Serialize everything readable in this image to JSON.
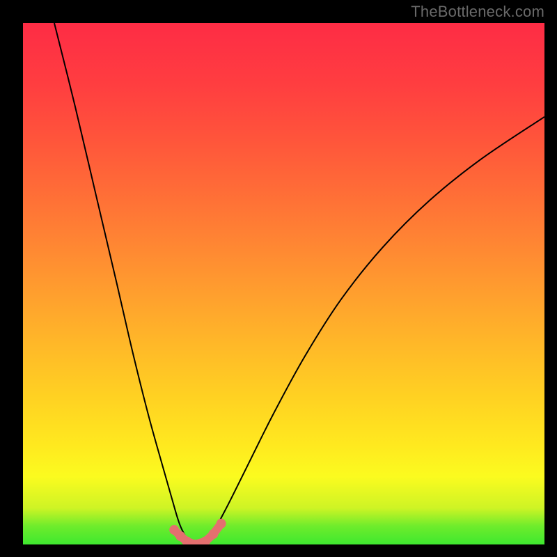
{
  "domain": "Chart",
  "attribution": "TheBottleneck.com",
  "colors": {
    "page_bg": "#000000",
    "attribution_text": "#6a6a6a",
    "curve_stroke": "#000000",
    "marker_fill": "#e46f6f",
    "gradient": [
      "#3ee82f",
      "#fbfb1f",
      "#ff9f2e",
      "#ff543b",
      "#fe2c45"
    ]
  },
  "chart_data": {
    "type": "line",
    "title": "",
    "xlabel": "",
    "ylabel": "",
    "xlim": [
      0,
      100
    ],
    "ylim": [
      0,
      100
    ],
    "grid": false,
    "note": "Values below are estimated from pixel positions; axes are unlabeled in the source image so units are normalized 0–100.",
    "series": [
      {
        "name": "left-branch",
        "x": [
          6.0,
          10.0,
          14.0,
          18.0,
          21.0,
          24.0,
          26.5,
          28.5,
          30.0,
          31.5,
          32.5,
          33.0
        ],
        "y": [
          100.0,
          84.0,
          67.0,
          50.0,
          37.0,
          25.0,
          16.0,
          9.0,
          4.0,
          1.0,
          0.1,
          0.0
        ]
      },
      {
        "name": "right-branch",
        "x": [
          33.0,
          34.5,
          36.5,
          39.0,
          43.0,
          48.0,
          54.0,
          61.0,
          69.0,
          78.0,
          88.0,
          100.0
        ],
        "y": [
          0.0,
          0.4,
          2.5,
          7.0,
          15.0,
          25.0,
          36.0,
          47.0,
          57.0,
          66.0,
          74.0,
          82.0
        ]
      }
    ],
    "markers": {
      "name": "valley-highlight",
      "x": [
        29.0,
        30.2,
        31.4,
        33.0,
        35.0,
        36.5,
        38.0
      ],
      "y": [
        2.8,
        1.6,
        0.6,
        0.0,
        0.6,
        2.0,
        4.0
      ]
    }
  }
}
